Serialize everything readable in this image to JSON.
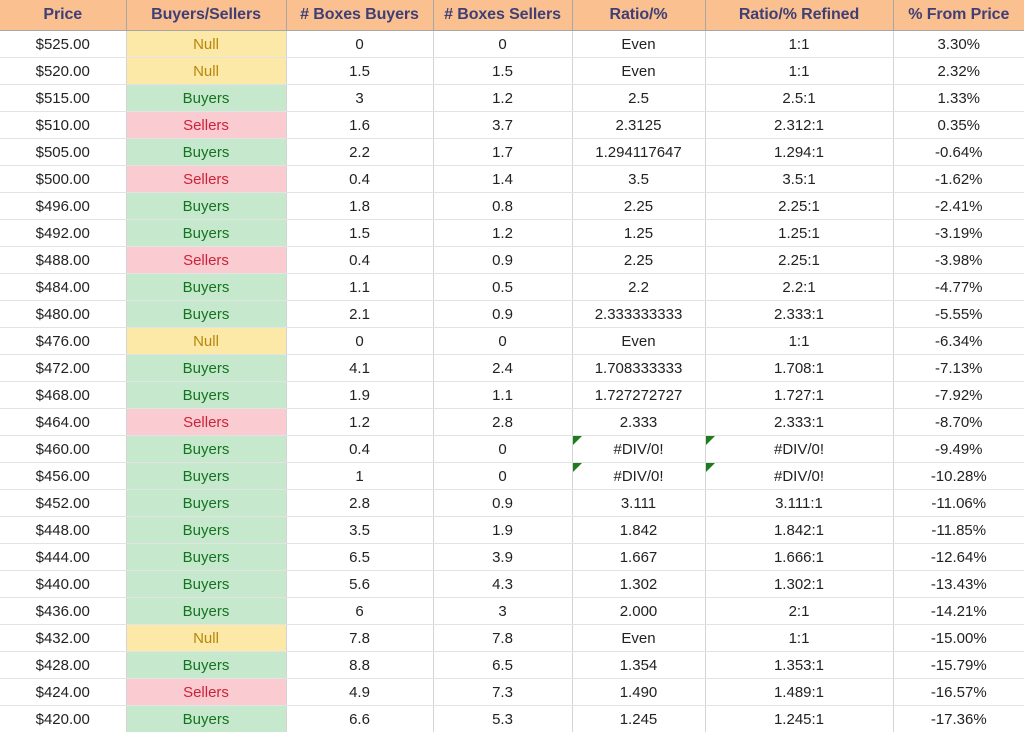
{
  "table": {
    "columns": [
      "Price",
      "Buyers/Sellers",
      "# Boxes Buyers",
      "# Boxes Sellers",
      "Ratio/%",
      "Ratio/% Refined",
      "% From Price"
    ],
    "colors": {
      "header_background": "#fac090",
      "header_text": "#3f3f76",
      "buyers_background": "#c6e9ce",
      "buyers_text": "#14731f",
      "sellers_background": "#fbcbd2",
      "sellers_text": "#cc2338",
      "null_background": "#fce9a8",
      "null_text": "#b8860b",
      "error_marker": "#1e7c1e",
      "cell_text": "#222222"
    },
    "rows": [
      {
        "price": "$525.00",
        "status": "Null",
        "boxes_buyers": "0",
        "boxes_sellers": "0",
        "ratio": "Even",
        "ratio_refined": "1:1",
        "pct_from_price": "3.30%",
        "error": false
      },
      {
        "price": "$520.00",
        "status": "Null",
        "boxes_buyers": "1.5",
        "boxes_sellers": "1.5",
        "ratio": "Even",
        "ratio_refined": "1:1",
        "pct_from_price": "2.32%",
        "error": false
      },
      {
        "price": "$515.00",
        "status": "Buyers",
        "boxes_buyers": "3",
        "boxes_sellers": "1.2",
        "ratio": "2.5",
        "ratio_refined": "2.5:1",
        "pct_from_price": "1.33%",
        "error": false
      },
      {
        "price": "$510.00",
        "status": "Sellers",
        "boxes_buyers": "1.6",
        "boxes_sellers": "3.7",
        "ratio": "2.3125",
        "ratio_refined": "2.312:1",
        "pct_from_price": "0.35%",
        "error": false
      },
      {
        "price": "$505.00",
        "status": "Buyers",
        "boxes_buyers": "2.2",
        "boxes_sellers": "1.7",
        "ratio": "1.294117647",
        "ratio_refined": "1.294:1",
        "pct_from_price": "-0.64%",
        "error": false
      },
      {
        "price": "$500.00",
        "status": "Sellers",
        "boxes_buyers": "0.4",
        "boxes_sellers": "1.4",
        "ratio": "3.5",
        "ratio_refined": "3.5:1",
        "pct_from_price": "-1.62%",
        "error": false
      },
      {
        "price": "$496.00",
        "status": "Buyers",
        "boxes_buyers": "1.8",
        "boxes_sellers": "0.8",
        "ratio": "2.25",
        "ratio_refined": "2.25:1",
        "pct_from_price": "-2.41%",
        "error": false
      },
      {
        "price": "$492.00",
        "status": "Buyers",
        "boxes_buyers": "1.5",
        "boxes_sellers": "1.2",
        "ratio": "1.25",
        "ratio_refined": "1.25:1",
        "pct_from_price": "-3.19%",
        "error": false
      },
      {
        "price": "$488.00",
        "status": "Sellers",
        "boxes_buyers": "0.4",
        "boxes_sellers": "0.9",
        "ratio": "2.25",
        "ratio_refined": "2.25:1",
        "pct_from_price": "-3.98%",
        "error": false
      },
      {
        "price": "$484.00",
        "status": "Buyers",
        "boxes_buyers": "1.1",
        "boxes_sellers": "0.5",
        "ratio": "2.2",
        "ratio_refined": "2.2:1",
        "pct_from_price": "-4.77%",
        "error": false
      },
      {
        "price": "$480.00",
        "status": "Buyers",
        "boxes_buyers": "2.1",
        "boxes_sellers": "0.9",
        "ratio": "2.333333333",
        "ratio_refined": "2.333:1",
        "pct_from_price": "-5.55%",
        "error": false
      },
      {
        "price": "$476.00",
        "status": "Null",
        "boxes_buyers": "0",
        "boxes_sellers": "0",
        "ratio": "Even",
        "ratio_refined": "1:1",
        "pct_from_price": "-6.34%",
        "error": false
      },
      {
        "price": "$472.00",
        "status": "Buyers",
        "boxes_buyers": "4.1",
        "boxes_sellers": "2.4",
        "ratio": "1.708333333",
        "ratio_refined": "1.708:1",
        "pct_from_price": "-7.13%",
        "error": false
      },
      {
        "price": "$468.00",
        "status": "Buyers",
        "boxes_buyers": "1.9",
        "boxes_sellers": "1.1",
        "ratio": "1.727272727",
        "ratio_refined": "1.727:1",
        "pct_from_price": "-7.92%",
        "error": false
      },
      {
        "price": "$464.00",
        "status": "Sellers",
        "boxes_buyers": "1.2",
        "boxes_sellers": "2.8",
        "ratio": "2.333",
        "ratio_refined": "2.333:1",
        "pct_from_price": "-8.70%",
        "error": false
      },
      {
        "price": "$460.00",
        "status": "Buyers",
        "boxes_buyers": "0.4",
        "boxes_sellers": "0",
        "ratio": "#DIV/0!",
        "ratio_refined": "#DIV/0!",
        "pct_from_price": "-9.49%",
        "error": true
      },
      {
        "price": "$456.00",
        "status": "Buyers",
        "boxes_buyers": "1",
        "boxes_sellers": "0",
        "ratio": "#DIV/0!",
        "ratio_refined": "#DIV/0!",
        "pct_from_price": "-10.28%",
        "error": true
      },
      {
        "price": "$452.00",
        "status": "Buyers",
        "boxes_buyers": "2.8",
        "boxes_sellers": "0.9",
        "ratio": "3.111",
        "ratio_refined": "3.111:1",
        "pct_from_price": "-11.06%",
        "error": false
      },
      {
        "price": "$448.00",
        "status": "Buyers",
        "boxes_buyers": "3.5",
        "boxes_sellers": "1.9",
        "ratio": "1.842",
        "ratio_refined": "1.842:1",
        "pct_from_price": "-11.85%",
        "error": false
      },
      {
        "price": "$444.00",
        "status": "Buyers",
        "boxes_buyers": "6.5",
        "boxes_sellers": "3.9",
        "ratio": "1.667",
        "ratio_refined": "1.666:1",
        "pct_from_price": "-12.64%",
        "error": false
      },
      {
        "price": "$440.00",
        "status": "Buyers",
        "boxes_buyers": "5.6",
        "boxes_sellers": "4.3",
        "ratio": "1.302",
        "ratio_refined": "1.302:1",
        "pct_from_price": "-13.43%",
        "error": false
      },
      {
        "price": "$436.00",
        "status": "Buyers",
        "boxes_buyers": "6",
        "boxes_sellers": "3",
        "ratio": "2.000",
        "ratio_refined": "2:1",
        "pct_from_price": "-14.21%",
        "error": false
      },
      {
        "price": "$432.00",
        "status": "Null",
        "boxes_buyers": "7.8",
        "boxes_sellers": "7.8",
        "ratio": "Even",
        "ratio_refined": "1:1",
        "pct_from_price": "-15.00%",
        "error": false
      },
      {
        "price": "$428.00",
        "status": "Buyers",
        "boxes_buyers": "8.8",
        "boxes_sellers": "6.5",
        "ratio": "1.354",
        "ratio_refined": "1.353:1",
        "pct_from_price": "-15.79%",
        "error": false
      },
      {
        "price": "$424.00",
        "status": "Sellers",
        "boxes_buyers": "4.9",
        "boxes_sellers": "7.3",
        "ratio": "1.490",
        "ratio_refined": "1.489:1",
        "pct_from_price": "-16.57%",
        "error": false
      },
      {
        "price": "$420.00",
        "status": "Buyers",
        "boxes_buyers": "6.6",
        "boxes_sellers": "5.3",
        "ratio": "1.245",
        "ratio_refined": "1.245:1",
        "pct_from_price": "-17.36%",
        "error": false
      }
    ]
  }
}
